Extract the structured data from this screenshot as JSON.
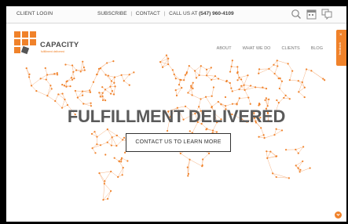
{
  "topbar": {
    "client_login": "CLIENT LOGIN",
    "subscribe": "SUBSCRIBE",
    "contact": "CONTACT",
    "call_us": "CALL US AT",
    "phone": "(547) 960-4109",
    "separator": "|",
    "icons": [
      "search-icon",
      "calendar-icon",
      "chat-icon"
    ]
  },
  "header": {
    "logo_name": "CAPACITY",
    "logo_tagline": "fulfillment delivered",
    "nav": [
      "ABOUT",
      "WHAT WE DO",
      "CLIENTS",
      "BLOG"
    ],
    "side_tab_close": "×",
    "side_tab_label": "feedback"
  },
  "hero": {
    "title": "FULFILLMENT DELIVERED",
    "cta_label": "CONTACT US TO LEARN MORE"
  },
  "colors": {
    "brand_orange": "#f0822a",
    "text_dark": "#5a5a5a",
    "map_line": "#f4a46a"
  }
}
